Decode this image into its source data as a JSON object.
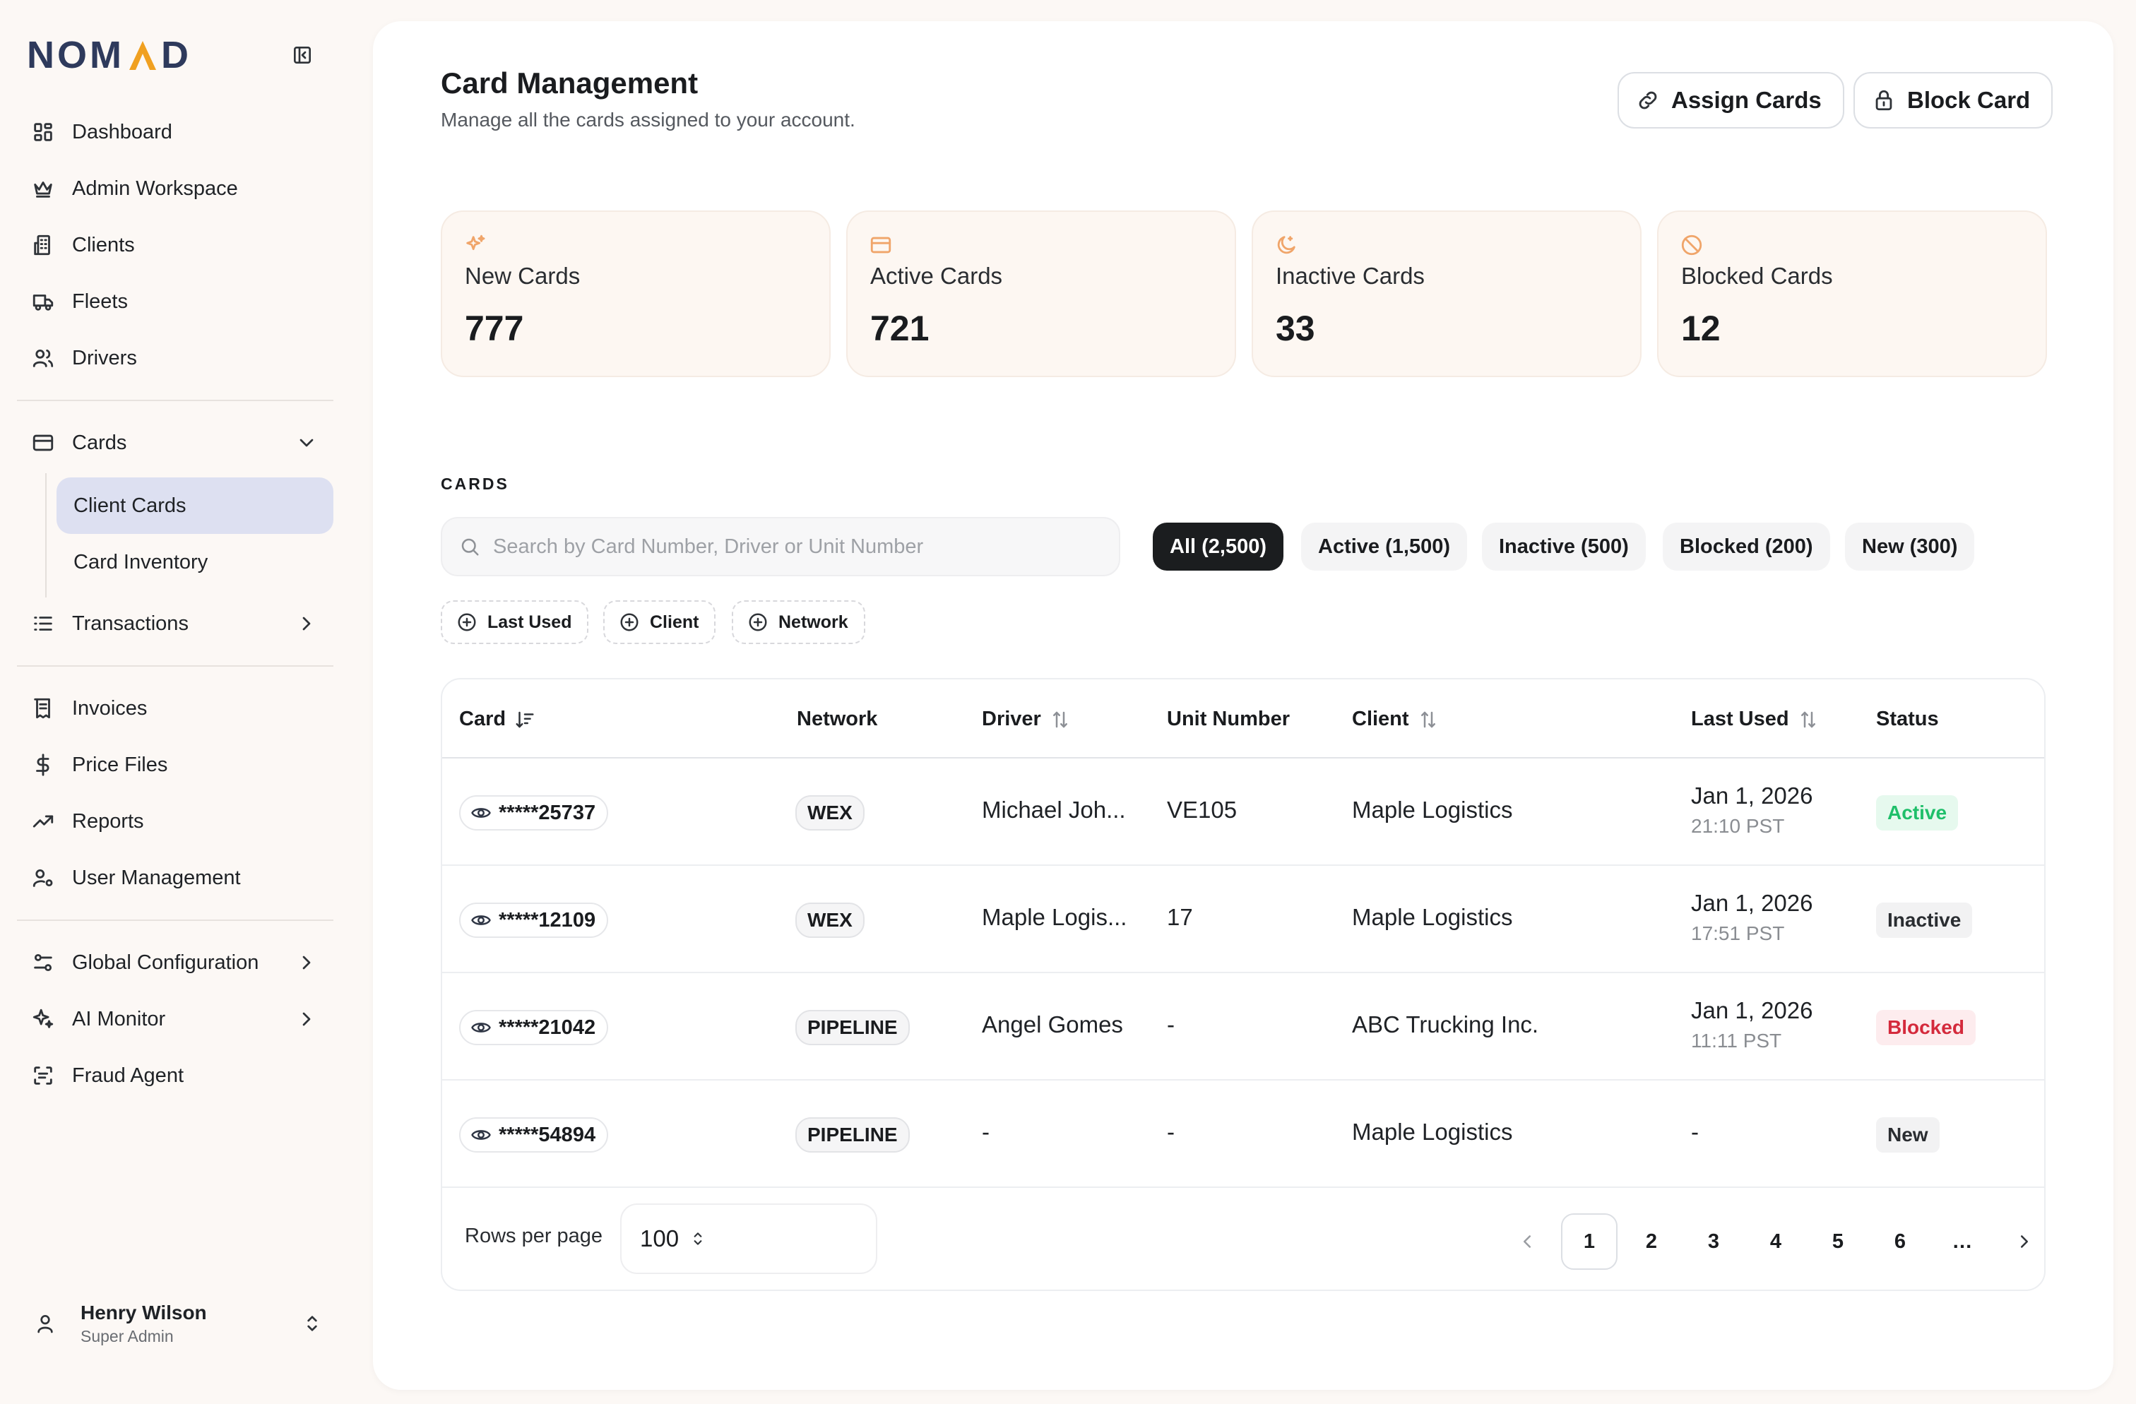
{
  "brand": {
    "logo_text_left": "NOM",
    "logo_text_right": "D"
  },
  "sidebar": {
    "nav_top": [
      {
        "label": "Dashboard",
        "icon": "dashboard-icon"
      },
      {
        "label": "Admin Workspace",
        "icon": "crown-icon"
      },
      {
        "label": "Clients",
        "icon": "building-icon"
      },
      {
        "label": "Fleets",
        "icon": "truck-icon"
      },
      {
        "label": "Drivers",
        "icon": "users-icon"
      }
    ],
    "cards": {
      "label": "Cards",
      "icon": "credit-card-icon"
    },
    "cards_sub": [
      {
        "label": "Client Cards",
        "active": true
      },
      {
        "label": "Card Inventory",
        "active": false
      }
    ],
    "transactions": {
      "label": "Transactions",
      "icon": "list-icon"
    },
    "nav_mid": [
      {
        "label": "Invoices",
        "icon": "receipt-icon"
      },
      {
        "label": "Price Files",
        "icon": "dollar-icon"
      },
      {
        "label": "Reports",
        "icon": "trending-icon"
      },
      {
        "label": "User Management",
        "icon": "user-cog-icon"
      }
    ],
    "nav_bottom": [
      {
        "label": "Global Configuration",
        "icon": "sliders-icon"
      },
      {
        "label": "AI Monitor",
        "icon": "sparkles-icon"
      },
      {
        "label": "Fraud Agent",
        "icon": "scan-icon"
      }
    ],
    "user": {
      "name": "Henry Wilson",
      "role": "Super Admin"
    }
  },
  "header": {
    "title": "Card Management",
    "subtitle": "Manage all the cards assigned to your account.",
    "assign_label": "Assign Cards",
    "block_label": "Block Card"
  },
  "stats": [
    {
      "label": "New Cards",
      "value": "777",
      "icon": "sparkle-icon"
    },
    {
      "label": "Active Cards",
      "value": "721",
      "icon": "credit-card-icon"
    },
    {
      "label": "Inactive Cards",
      "value": "33",
      "icon": "moon-icon"
    },
    {
      "label": "Blocked Cards",
      "value": "12",
      "icon": "ban-icon"
    }
  ],
  "cards_section": {
    "label": "CARDS",
    "search_placeholder": "Search by Card Number, Driver or Unit Number",
    "tabs": [
      {
        "label": "All (2,500)",
        "active": true
      },
      {
        "label": "Active (1,500)",
        "active": false
      },
      {
        "label": "Inactive (500)",
        "active": false
      },
      {
        "label": "Blocked (200)",
        "active": false
      },
      {
        "label": "New (300)",
        "active": false
      }
    ],
    "filters": [
      "Last Used",
      "Client",
      "Network"
    ]
  },
  "table": {
    "columns": [
      "Card",
      "Network",
      "Driver",
      "Unit Number",
      "Client",
      "Last Used",
      "Status"
    ],
    "rows": [
      {
        "card": "*****25737",
        "network": "WEX",
        "driver": "Michael Joh...",
        "unit": "VE105",
        "client": "Maple Logistics",
        "date": "Jan 1, 2026",
        "time": "21:10 PST",
        "status": "Active"
      },
      {
        "card": "*****12109",
        "network": "WEX",
        "driver": "Maple Logis...",
        "unit": "17",
        "client": "Maple Logistics",
        "date": "Jan 1, 2026",
        "time": "17:51 PST",
        "status": "Inactive"
      },
      {
        "card": "*****21042",
        "network": "PIPELINE",
        "driver": "Angel Gomes",
        "unit": "-",
        "client": "ABC Trucking Inc.",
        "date": "Jan 1, 2026",
        "time": "11:11 PST",
        "status": "Blocked"
      },
      {
        "card": "*****54894",
        "network": "PIPELINE",
        "driver": "-",
        "unit": "-",
        "client": "Maple Logistics",
        "date": "-",
        "time": "",
        "status": "New"
      }
    ],
    "status_colors": {
      "Active": {
        "bg": "#e6f9ee",
        "fg": "#1fbf6a"
      },
      "Inactive": {
        "bg": "#f2f2f3",
        "fg": "#2a2d31"
      },
      "Blocked": {
        "bg": "#fdecee",
        "fg": "#d42a3c"
      },
      "New": {
        "bg": "#f2f2f3",
        "fg": "#2a2d31"
      }
    },
    "rows_per_page_label": "Rows per page",
    "rows_per_page": "100",
    "pages": [
      "1",
      "2",
      "3",
      "4",
      "5",
      "6"
    ],
    "ellipsis": "…",
    "current_page": "1"
  },
  "colors": {
    "accent_orange": "#f0a020",
    "brand_navy": "#2e3a5c",
    "active_nav": "#dde0f1"
  }
}
